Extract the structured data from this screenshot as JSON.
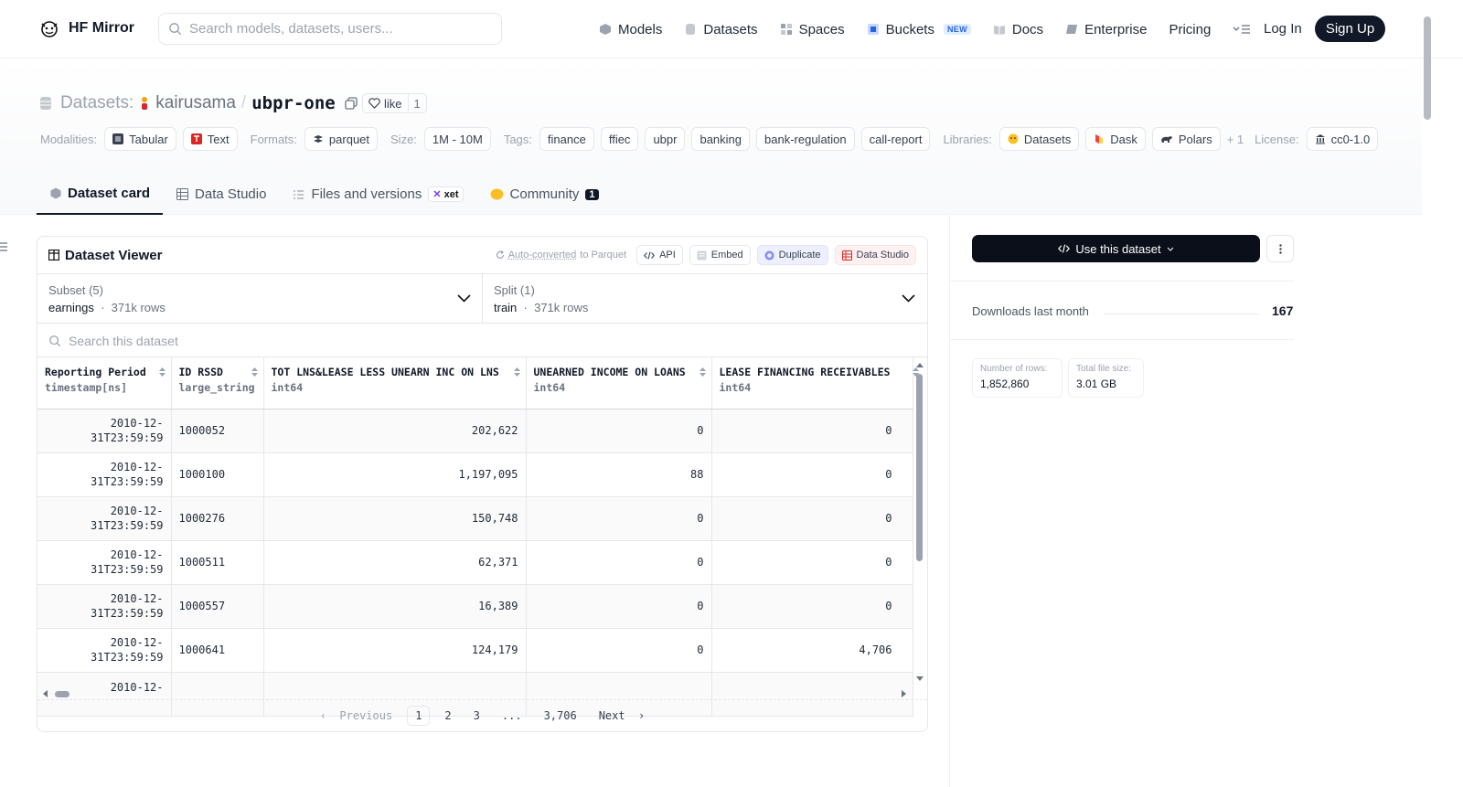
{
  "header": {
    "brand": "HF Mirror",
    "search_placeholder": "Search models, datasets, users...",
    "nav": [
      {
        "label": "Models"
      },
      {
        "label": "Datasets"
      },
      {
        "label": "Spaces"
      },
      {
        "label": "Buckets",
        "badge": "NEW"
      },
      {
        "label": "Docs"
      },
      {
        "label": "Enterprise"
      },
      {
        "label": "Pricing"
      }
    ],
    "login": "Log In",
    "signup": "Sign Up"
  },
  "repo": {
    "type_label": "Datasets:",
    "owner": "kairusama",
    "separator": "/",
    "name": "ubpr-one",
    "like_label": "like",
    "like_count": "1"
  },
  "meta": {
    "modalities_label": "Modalities:",
    "modalities": [
      "Tabular",
      "Text"
    ],
    "formats_label": "Formats:",
    "formats": [
      "parquet"
    ],
    "size_label": "Size:",
    "size": "1M - 10M",
    "tags_label": "Tags:",
    "tags": [
      "finance",
      "ffiec",
      "ubpr",
      "banking",
      "bank-regulation",
      "call-report"
    ],
    "libraries_label": "Libraries:",
    "libraries": [
      "Datasets",
      "Dask",
      "Polars"
    ],
    "libraries_more": "+ 1",
    "license_label": "License:",
    "license": "cc0-1.0"
  },
  "tabs": {
    "card": "Dataset card",
    "studio": "Data Studio",
    "files": "Files and versions",
    "xet": "xet",
    "community": "Community",
    "community_count": "1"
  },
  "viewer": {
    "title": "Dataset Viewer",
    "autoconv": "Auto-converted",
    "autoconv_suffix": "to Parquet",
    "api": "API",
    "embed": "Embed",
    "duplicate": "Duplicate",
    "studio": "Data Studio",
    "subset_label": "Subset (5)",
    "subset_value": "earnings",
    "subset_rows": "371k rows",
    "split_label": "Split (1)",
    "split_value": "train",
    "split_rows": "371k rows",
    "search_placeholder": "Search this dataset",
    "columns": [
      {
        "name": "Reporting Period",
        "type": "timestamp[ns]"
      },
      {
        "name": "ID RSSD",
        "type": "large_string"
      },
      {
        "name": "TOT LNS&LEASE LESS UNEARN INC ON LNS",
        "type": "int64"
      },
      {
        "name": "UNEARNED INCOME ON LOANS",
        "type": "int64"
      },
      {
        "name": "LEASE FINANCING RECEIVABLES",
        "type": "int64"
      }
    ],
    "rows": [
      {
        "date1": "2010-12-",
        "date2": "31T23:59:59",
        "id": "1000052",
        "a": "202,622",
        "b": "0",
        "c": "0"
      },
      {
        "date1": "2010-12-",
        "date2": "31T23:59:59",
        "id": "1000100",
        "a": "1,197,095",
        "b": "88",
        "c": "0"
      },
      {
        "date1": "2010-12-",
        "date2": "31T23:59:59",
        "id": "1000276",
        "a": "150,748",
        "b": "0",
        "c": "0"
      },
      {
        "date1": "2010-12-",
        "date2": "31T23:59:59",
        "id": "1000511",
        "a": "62,371",
        "b": "0",
        "c": "0"
      },
      {
        "date1": "2010-12-",
        "date2": "31T23:59:59",
        "id": "1000557",
        "a": "16,389",
        "b": "0",
        "c": "0"
      },
      {
        "date1": "2010-12-",
        "date2": "31T23:59:59",
        "id": "1000641",
        "a": "124,179",
        "b": "0",
        "c": "4,706"
      },
      {
        "date1": "2010-12-",
        "date2": "",
        "id": "",
        "a": "",
        "b": "",
        "c": ""
      }
    ],
    "pager": {
      "prev": "Previous",
      "pages": [
        "1",
        "2",
        "3",
        "...",
        "3,706"
      ],
      "next": "Next"
    }
  },
  "sidebar": {
    "use_dataset": "Use this dataset",
    "downloads_label": "Downloads last month",
    "downloads_value": "167",
    "rows_label": "Number of rows:",
    "rows_value": "1,852,860",
    "size_label": "Total file size:",
    "size_value": "3.01 GB"
  }
}
